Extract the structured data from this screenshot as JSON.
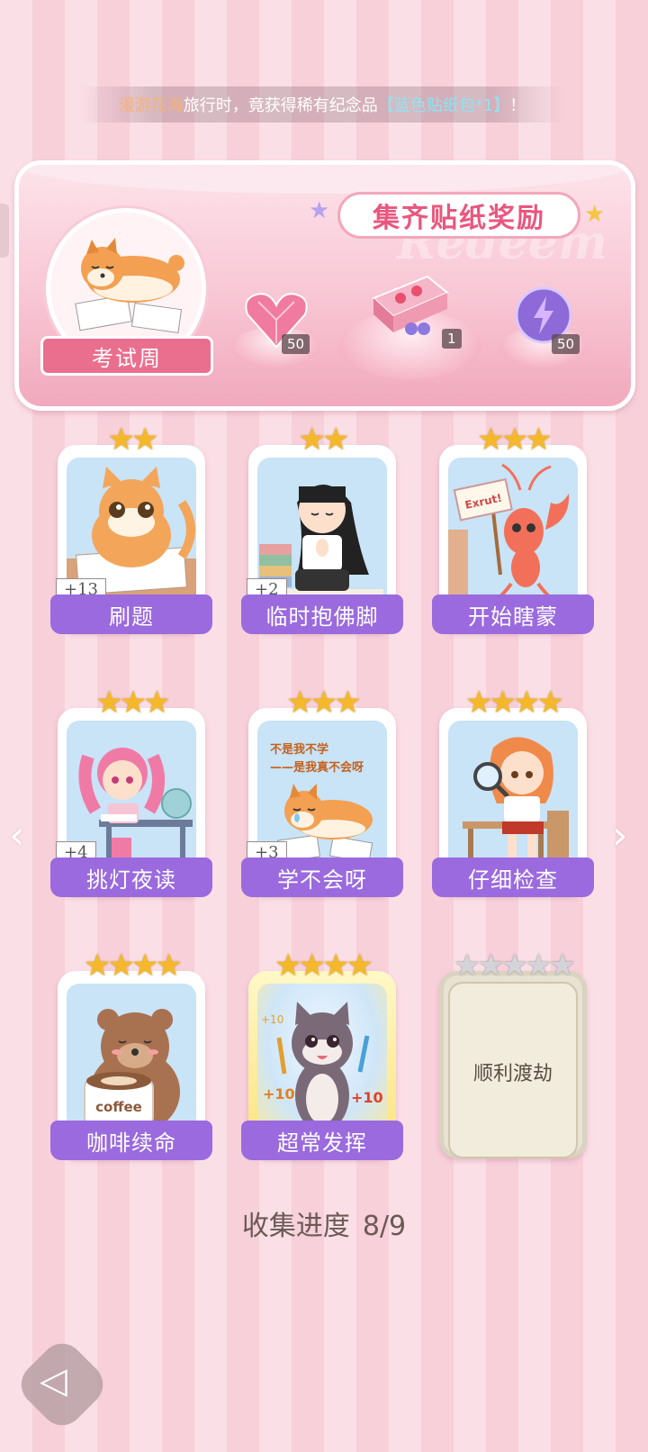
{
  "notice": {
    "place": "漫游花海",
    "text1": "旅行时，竟获得稀有纪念品",
    "item": "【蓝色贴纸包*1】",
    "text2": "！"
  },
  "banner": {
    "title": "集齐贴纸奖励",
    "watermark": "Redeem",
    "theme_label": "考试周",
    "rewards": [
      {
        "icon": "heart-gem-icon",
        "count": "50"
      },
      {
        "icon": "gift-box-icon",
        "count": "1"
      },
      {
        "icon": "energy-orb-icon",
        "count": "50"
      }
    ]
  },
  "stickers": [
    {
      "name": "刷题",
      "stars": 2,
      "bonus": "+13",
      "icon": "cat-studying-icon"
    },
    {
      "name": "临时抱佛脚",
      "stars": 2,
      "bonus": "+2",
      "icon": "girl-praying-icon"
    },
    {
      "name": "开始瞎蒙",
      "stars": 3,
      "bonus": "",
      "icon": "shrimp-sign-icon",
      "sign": "Exrut!"
    },
    {
      "name": "挑灯夜读",
      "stars": 3,
      "bonus": "+4",
      "icon": "girl-reading-icon"
    },
    {
      "name": "学不会呀",
      "stars": 3,
      "bonus": "+3",
      "icon": "shiba-crying-icon",
      "caption1": "不是我不学",
      "caption2": "——是我真不会呀"
    },
    {
      "name": "仔细检查",
      "stars": 4,
      "bonus": "",
      "icon": "girl-magnifier-icon"
    },
    {
      "name": "咖啡续命",
      "stars": 4,
      "bonus": "",
      "icon": "bear-coffee-icon",
      "cup": "coffee"
    },
    {
      "name": "超常发挥",
      "stars": 4,
      "bonus": "",
      "icon": "cat-pencils-icon",
      "plus_left": "+10",
      "plus_right": "+10",
      "plus_top": "+10"
    },
    {
      "name": "顺利渡劫",
      "stars": 5,
      "bonus": "",
      "icon": "locked-card-icon",
      "locked": true
    }
  ],
  "progress": {
    "label": "收集进度",
    "value": "8/9"
  }
}
